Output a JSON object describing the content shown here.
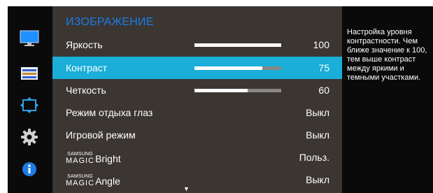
{
  "menu": {
    "title": "ИЗОБРАЖЕНИЕ",
    "items": [
      {
        "label": "Яркость",
        "value": "100",
        "bar": 1.0
      },
      {
        "label": "Контраст",
        "value": "75",
        "bar": 0.78,
        "selected": true
      },
      {
        "label": "Четкость",
        "value": "60",
        "bar": 0.6
      },
      {
        "label": "Режим отдыха глаз",
        "value": "Выкл"
      },
      {
        "label": "Игровой режим",
        "value": "Выкл"
      },
      {
        "brand_top": "SAMSUNG",
        "brand_bottom": "MAGIC",
        "label": "Bright",
        "value": "Польз."
      },
      {
        "brand_top": "SAMSUNG",
        "brand_bottom": "MAGIC",
        "label": "Angle",
        "value": "Выкл"
      }
    ],
    "scroll_indicator": "▼"
  },
  "help": {
    "text": "Настройка уровня контрастности. Чем ближе значение к 100, тем выше контраст между яркими и темными участками."
  },
  "sidebar": {
    "icons": [
      {
        "name": "picture-icon",
        "color": "#1e90ff"
      },
      {
        "name": "onscreen-display-icon",
        "color": "#3a5fcd"
      },
      {
        "name": "screen-size-icon",
        "color": "#2aa0e8"
      },
      {
        "name": "gear-icon",
        "color": "#d0d0d0"
      },
      {
        "name": "info-icon",
        "color": "#1e7be6"
      }
    ]
  },
  "colors": {
    "highlight": "#1aaed8",
    "title": "#1e7be6",
    "panel": "#3b3632"
  }
}
